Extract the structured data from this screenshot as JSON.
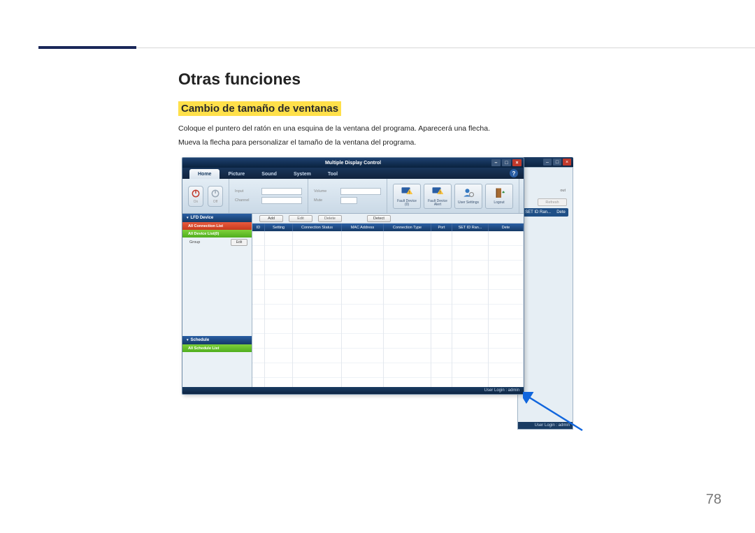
{
  "page": {
    "number": "78",
    "h1": "Otras funciones",
    "h2": "Cambio de tamaño de ventanas",
    "p1": "Coloque el puntero del ratón en una esquina de la ventana del programa. Aparecerá una flecha.",
    "p2": "Mueva la flecha para personalizar el tamaño de la ventana del programa."
  },
  "app": {
    "title": "Multiple Display Control",
    "tabs": [
      "Home",
      "Picture",
      "Sound",
      "System",
      "Tool"
    ],
    "help": "?",
    "power": {
      "on_label": "On",
      "off_label": "Off"
    },
    "fields": {
      "input": "Input",
      "channel": "Channel",
      "volume": "Volume",
      "mute": "Mute"
    },
    "rbuttons": {
      "fault_device": "Fault Device (0)",
      "fault_alert": "Fault Device Alert",
      "user_settings": "User Settings",
      "logout": "Logout"
    },
    "sidebar": {
      "lfd": "LFD Device",
      "all_conn": "All Connection List",
      "all_dev": "All Device List(0)",
      "group": "Group",
      "edit": "Edit",
      "schedule": "Schedule",
      "all_sched": "All Schedule List"
    },
    "toolbar": {
      "add": "Add",
      "edit": "Edit",
      "delete": "Delete",
      "detect": "Detect"
    },
    "grid_headers": {
      "id": "ID",
      "setting": "Setting",
      "conn_status": "Connection Status",
      "mac": "MAC Address",
      "conn_type": "Connection Type",
      "port": "Port",
      "set_id": "SET ID Ran...",
      "dete": "Dete"
    },
    "status": "User Login : admin"
  },
  "bgwin": {
    "refresh": "Refresh",
    "out": "out",
    "col_setid": "SET ID Ran...",
    "col_dete": "Dete",
    "status": "User Login : admin"
  }
}
